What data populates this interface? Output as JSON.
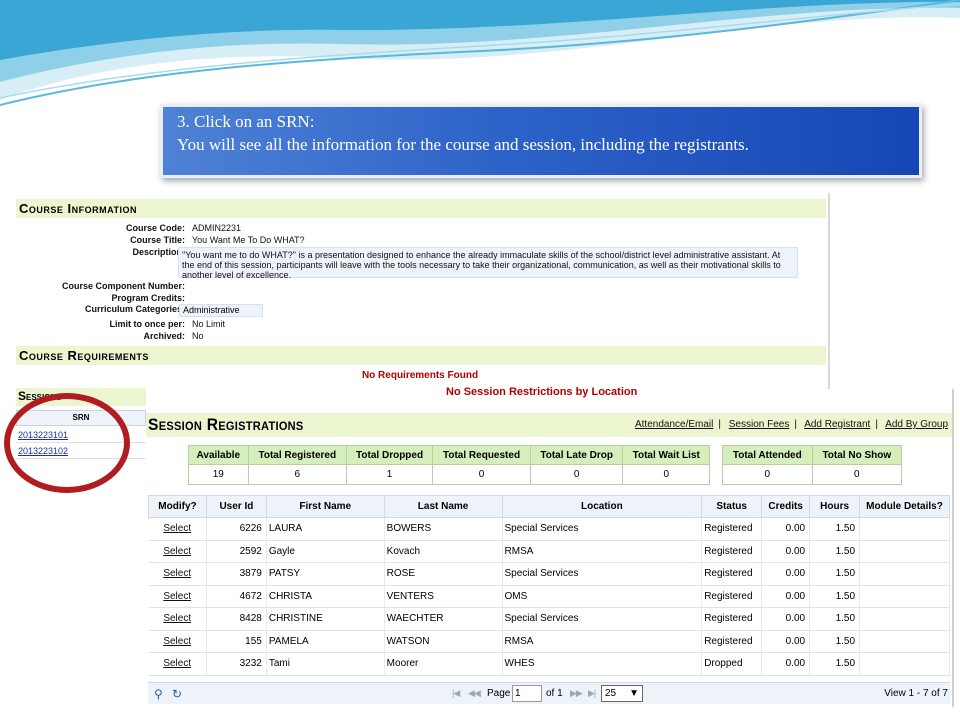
{
  "callout": {
    "line1": "3. Click on an SRN:",
    "line2": "You will see all the information for the course and session, including the registrants."
  },
  "course_info": {
    "heading": "Course Information",
    "fields": [
      {
        "label": "Course Code:",
        "value": "ADMIN2231"
      },
      {
        "label": "Course Title:",
        "value": "You Want Me To Do WHAT?"
      },
      {
        "label": "Description:",
        "value": "\"You want me to do WHAT?\" is a presentation designed to enhance the already immaculate skills of the school/district level administrative assistant.  At the end of this session, participants will leave with the tools necessary to take their organizational, communication, as well as their motivational skills to another level of excellence."
      },
      {
        "label": "Course Component Number:",
        "value": ""
      },
      {
        "label": "Program Credits:",
        "value": ""
      },
      {
        "label": "Curriculum Categories:",
        "value": "Administrative"
      },
      {
        "label": "Limit to once per:",
        "value": "No Limit"
      },
      {
        "label": "Archived:",
        "value": "No"
      }
    ]
  },
  "requirements": {
    "heading": "Course Requirements",
    "empty": "No Requirements Found",
    "restriction": "No Session Restrictions by Location"
  },
  "sessions": {
    "heading": "Sessions",
    "column": "SRN",
    "srns": [
      "2013223101",
      "2013223102"
    ]
  },
  "registrations": {
    "heading": "Session Registrations",
    "links": [
      "Attendance/Email",
      "Session Fees",
      "Add Registrant",
      "Add By Group"
    ],
    "stats": {
      "headers": [
        "Available",
        "Total Registered",
        "Total Dropped",
        "Total Requested",
        "Total Late Drop",
        "Total Wait List"
      ],
      "values": [
        "19",
        "6",
        "1",
        "0",
        "0",
        "0"
      ]
    },
    "attendance": {
      "headers": [
        "Total Attended",
        "Total No Show"
      ],
      "values": [
        "0",
        "0"
      ]
    },
    "columns": [
      "Modify?",
      "User Id",
      "First Name",
      "Last Name",
      "Location",
      "Status",
      "Credits",
      "Hours",
      "Module Details?"
    ],
    "rows": [
      {
        "modify": "Select",
        "user_id": "6226",
        "first": "LAURA",
        "last": "BOWERS",
        "location": "Special Services",
        "status": "Registered",
        "credits": "0.00",
        "hours": "1.50",
        "details": ""
      },
      {
        "modify": "Select",
        "user_id": "2592",
        "first": "Gayle",
        "last": "Kovach",
        "location": "RMSA",
        "status": "Registered",
        "credits": "0.00",
        "hours": "1.50",
        "details": ""
      },
      {
        "modify": "Select",
        "user_id": "3879",
        "first": "PATSY",
        "last": "ROSE",
        "location": "Special Services",
        "status": "Registered",
        "credits": "0.00",
        "hours": "1.50",
        "details": ""
      },
      {
        "modify": "Select",
        "user_id": "4672",
        "first": "CHRISTA",
        "last": "VENTERS",
        "location": "OMS",
        "status": "Registered",
        "credits": "0.00",
        "hours": "1.50",
        "details": ""
      },
      {
        "modify": "Select",
        "user_id": "8428",
        "first": "CHRISTINE",
        "last": "WAECHTER",
        "location": "Special Services",
        "status": "Registered",
        "credits": "0.00",
        "hours": "1.50",
        "details": ""
      },
      {
        "modify": "Select",
        "user_id": "155",
        "first": "PAMELA",
        "last": "WATSON",
        "location": "RMSA",
        "status": "Registered",
        "credits": "0.00",
        "hours": "1.50",
        "details": ""
      },
      {
        "modify": "Select",
        "user_id": "3232",
        "first": "Tami",
        "last": "Moorer",
        "location": "WHES",
        "status": "Dropped",
        "credits": "0.00",
        "hours": "1.50",
        "details": ""
      }
    ],
    "pager": {
      "page_label": "Page",
      "page_value": "1",
      "of_label": "of 1",
      "rows_per_page": "25",
      "view_text": "View 1 - 7 of 7",
      "first_icon": "first-page-icon",
      "prev_icon": "prev-page-icon",
      "next_icon": "next-page-icon",
      "last_icon": "last-page-icon",
      "search_icon": "search-icon",
      "refresh_icon": "refresh-icon"
    }
  },
  "colors": {
    "callout_blue": "#1646b4",
    "section_green": "#ebf5cf",
    "stats_green": "#d6eebb",
    "ring_red": "#b01c20",
    "alert_red": "#b00000"
  }
}
